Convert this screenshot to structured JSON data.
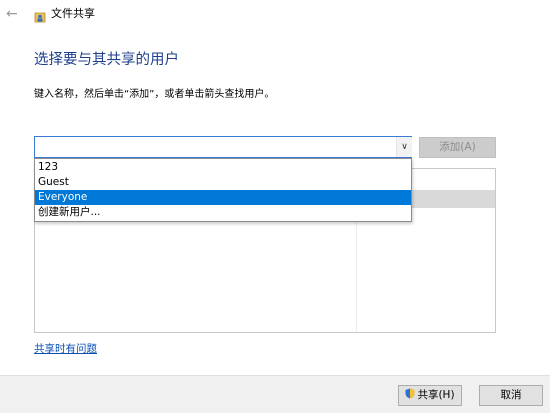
{
  "window": {
    "title": "文件共享",
    "back_icon": "back-arrow-icon",
    "title_icon": "file-sharing-icon"
  },
  "main": {
    "heading": "选择要与其共享的用户",
    "instruction": "键入名称，然后单击“添加”，或者单击箭头查找用户。",
    "combo": {
      "value": "",
      "dropdown_icon": "chevron-down-icon"
    },
    "add_button_label": "添加(A)",
    "dropdown_options": [
      {
        "label": "123",
        "selected": false
      },
      {
        "label": "Guest",
        "selected": false
      },
      {
        "label": "Everyone",
        "selected": true
      },
      {
        "label": "创建新用户...",
        "selected": false
      }
    ],
    "help_link": "共享时有问题"
  },
  "footer": {
    "share_button_label": "共享(H)",
    "share_icon": "uac-shield-icon",
    "cancel_button_label": "取消"
  },
  "colors": {
    "heading": "#1e3e8c",
    "selection": "#0078d7",
    "link": "#0b4fb5",
    "disabled_button": "#cccccc"
  }
}
